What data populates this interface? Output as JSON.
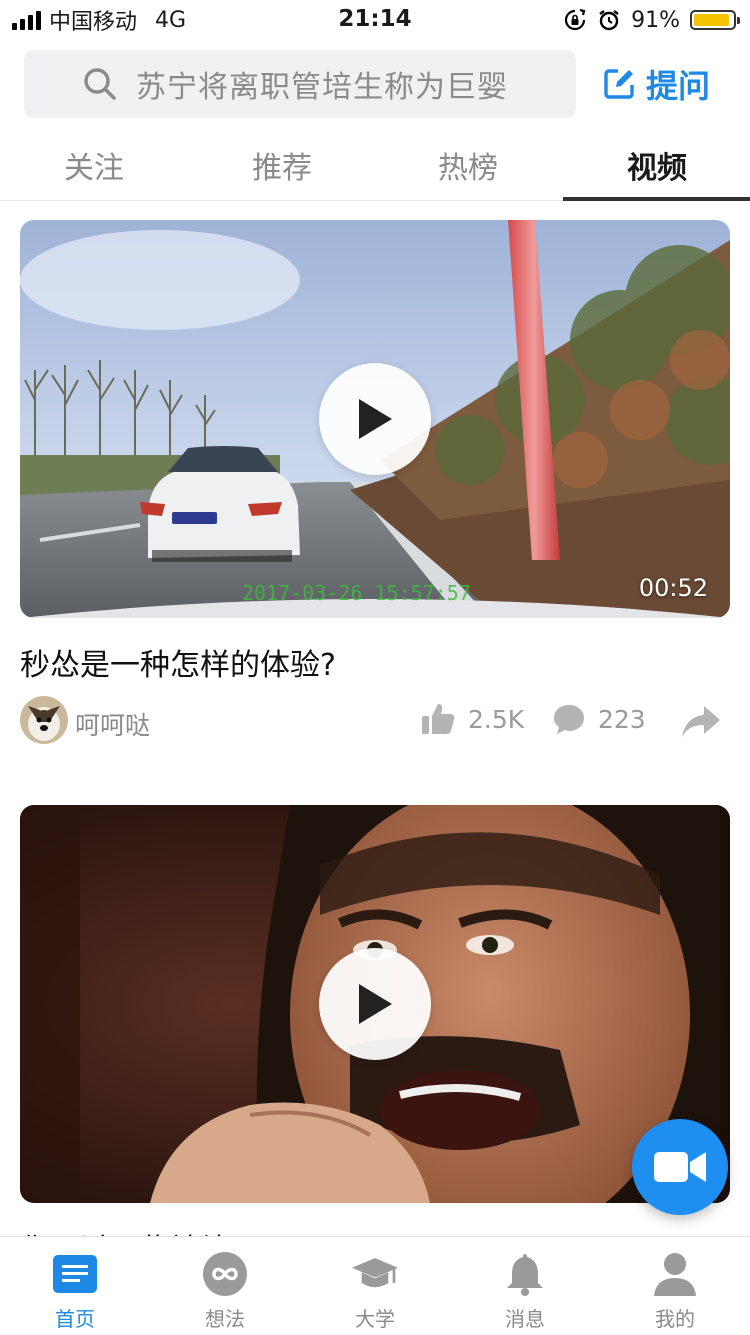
{
  "status_bar": {
    "carrier": "中国移动",
    "network": "4G",
    "time": "21:14",
    "battery": "91%",
    "battery_level": 0.91,
    "battery_color": "#f5c400"
  },
  "search": {
    "placeholder": "苏宁将离职管培生称为巨婴",
    "ask_label": "提问"
  },
  "tabs": [
    {
      "label": "关注",
      "active": false
    },
    {
      "label": "推荐",
      "active": false
    },
    {
      "label": "热榜",
      "active": false
    },
    {
      "label": "视频",
      "active": true
    }
  ],
  "feed": [
    {
      "title": "秒怂是一种怎样的体验?",
      "duration": "00:52",
      "author": "呵呵哒",
      "likes": "2.5K",
      "comments": "223",
      "overlay_stamp": "2017-03-26 15:57:57"
    },
    {
      "title": "你见过哪些神补刀?"
    }
  ],
  "bottom_nav": [
    {
      "label": "首页",
      "icon": "home-list-icon",
      "active": true
    },
    {
      "label": "想法",
      "icon": "infinity-icon",
      "active": false
    },
    {
      "label": "大学",
      "icon": "graduation-cap-icon",
      "active": false
    },
    {
      "label": "消息",
      "icon": "bell-icon",
      "active": false
    },
    {
      "label": "我的",
      "icon": "user-icon",
      "active": false
    }
  ],
  "colors": {
    "accent": "#1e88e5",
    "fab": "#1e8ef0"
  }
}
